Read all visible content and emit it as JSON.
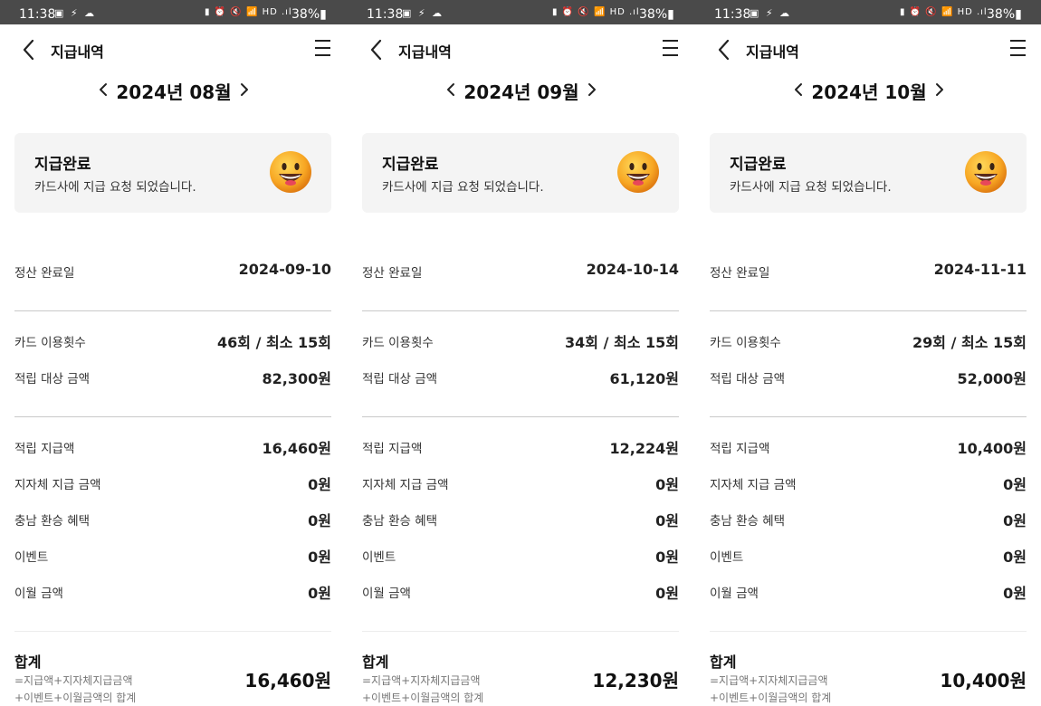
{
  "statusbar": {
    "time": "11:38",
    "left_icons": "▣ ⚡ ☁",
    "right_icons": "▮ ⏰ 🔇 📶 HD .ıl",
    "battery": "38%▮"
  },
  "app": {
    "title": "지급내역",
    "card_title": "지급완료",
    "card_desc": "카드사에 지급 요청 되었습니다.",
    "labels": {
      "settle_date": "정산 완료일",
      "card_uses": "카드 이용횟수",
      "accrual_base": "적립 대상 금액",
      "accrual_paid": "적립 지급액",
      "local_gov": "지자체 지급 금액",
      "chungnam": "충남 환승 혜택",
      "event": "이벤트",
      "carryover": "이월 금액",
      "total": "합계",
      "formula1": "=지급액+지자체지급금액",
      "formula2": "+이벤트+이월금액의 합계"
    }
  },
  "icons": {
    "back": "back-arrow-icon",
    "menu": "hamburger-menu-icon",
    "prev": "chevron-left-icon",
    "next": "chevron-right-icon",
    "smiley": "smiley-face-icon"
  },
  "colors": {
    "statusbar_bg": "#4a4a4a",
    "card_bg": "#f4f4f4",
    "smiley": "#f7a623"
  },
  "screens": [
    {
      "month": "2024년 08월",
      "settle_date": "2024-09-10",
      "card_uses": "46회 / 최소 15회",
      "accrual_base": "82,300원",
      "accrual_paid": "16,460원",
      "local_gov": "0원",
      "chungnam": "0원",
      "event": "0원",
      "carryover": "0원",
      "total": "16,460원"
    },
    {
      "month": "2024년 09월",
      "settle_date": "2024-10-14",
      "card_uses": "34회 / 최소 15회",
      "accrual_base": "61,120원",
      "accrual_paid": "12,224원",
      "local_gov": "0원",
      "chungnam": "0원",
      "event": "0원",
      "carryover": "0원",
      "total": "12,230원"
    },
    {
      "month": "2024년 10월",
      "settle_date": "2024-11-11",
      "card_uses": "29회 / 최소 15회",
      "accrual_base": "52,000원",
      "accrual_paid": "10,400원",
      "local_gov": "0원",
      "chungnam": "0원",
      "event": "0원",
      "carryover": "0원",
      "total": "10,400원"
    }
  ]
}
